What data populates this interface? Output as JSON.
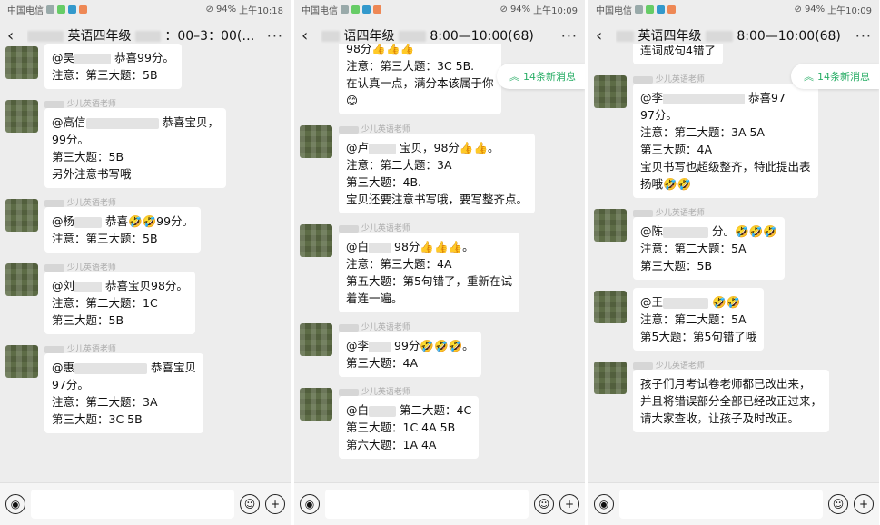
{
  "screens": [
    {
      "status": {
        "carrier": "中国电信",
        "battery": "94%",
        "time": "上午10:18"
      },
      "title": "英语四年级",
      "title_suffix": "：00–3：00(60)",
      "new_messages": "",
      "messages": [
        {
          "sender": "",
          "lines": [
            "@吴",
            "注意：第三大题：5B"
          ],
          "first_suffix": "恭喜99分。"
        },
        {
          "sender": "少儿英语老师",
          "lines": [
            "@高信",
            "99分。",
            "第三大题：5B",
            "另外注意书写哦"
          ],
          "first_suffix": "恭喜宝贝，"
        },
        {
          "sender": "少儿英语老师",
          "lines": [
            "@杨",
            "注意：第三大题：5B"
          ],
          "first_suffix": "恭喜🤣🤣99分。"
        },
        {
          "sender": "少儿英语老师",
          "lines": [
            "@刘",
            "注意：第二大题：1C",
            "第三大题：5B"
          ],
          "first_suffix": "恭喜宝贝98分。"
        },
        {
          "sender": "少儿英语老师",
          "lines": [
            "@惠",
            "97分。",
            "注意：第二大题：3A",
            "第三大题：3C 5B"
          ],
          "first_suffix": "恭喜宝贝"
        }
      ]
    },
    {
      "status": {
        "carrier": "中国电信",
        "battery": "94%",
        "time": "上午10:09"
      },
      "title": "语四年级",
      "title_suffix": "8:00—10:00(68)",
      "new_messages": "14条新消息",
      "messages": [
        {
          "sender": "",
          "lines": [
            "98分👍👍👍",
            "注意：第三大题：3C 5B.",
            "在认真一点，满分本该属于你",
            "😊"
          ],
          "first_suffix": ""
        },
        {
          "sender": "少儿英语老师",
          "lines": [
            "@卢",
            "注意：第二大题：3A",
            "第三大题：4B.",
            "宝贝还要注意书写哦，要写整齐点。"
          ],
          "first_suffix": "宝贝，98分👍👍。"
        },
        {
          "sender": "少儿英语老师",
          "lines": [
            "@白",
            "注意：第三大题：4A",
            "第五大题：第5句错了，重新在试",
            "着连一遍。"
          ],
          "first_suffix": "98分👍👍👍。"
        },
        {
          "sender": "少儿英语老师",
          "lines": [
            "@李",
            "第三大题：4A"
          ],
          "first_suffix": "99分🤣🤣🤣。"
        },
        {
          "sender": "少儿英语老师",
          "lines": [
            "@白",
            "第三大题：1C 4A 5B",
            "第六大题：1A 4A"
          ],
          "first_suffix": "第二大题：4C"
        }
      ]
    },
    {
      "status": {
        "carrier": "中国电信",
        "battery": "94%",
        "time": "上午10:09"
      },
      "title": "英语四年级",
      "title_suffix": "8:00—10:00(68)",
      "new_messages": "14条新消息",
      "messages": [
        {
          "sender": "",
          "lines": [
            "连词成句4错了"
          ],
          "first_suffix": ""
        },
        {
          "sender": "少儿英语老师",
          "lines": [
            "@李",
            "97分。",
            "注意：第二大题：3A 5A",
            "第三大题：4A",
            "宝贝书写也超级整齐，特此提出表",
            "扬哦🤣🤣"
          ],
          "first_suffix": "恭喜97"
        },
        {
          "sender": "少儿英语老师",
          "lines": [
            "@陈",
            "注意：第二大题：5A",
            "第三大题：5B"
          ],
          "first_suffix": "分。🤣🤣🤣"
        },
        {
          "sender": "少儿英语老师",
          "lines": [
            "@王",
            "注意：第二大题：5A",
            "第5大题：第5句错了哦"
          ],
          "first_suffix": "🤣🤣"
        },
        {
          "sender": "少儿英语老师",
          "lines": [
            "孩子们月考试卷老师都已改出来，",
            "并且将错误部分全部已经改正过来，",
            "请大家查收，让孩子及时改正。"
          ],
          "first_suffix": ""
        }
      ]
    }
  ],
  "icons": {
    "back": "‹",
    "more": "···",
    "voice": "◉",
    "emoji": "☺",
    "plus": "+"
  }
}
